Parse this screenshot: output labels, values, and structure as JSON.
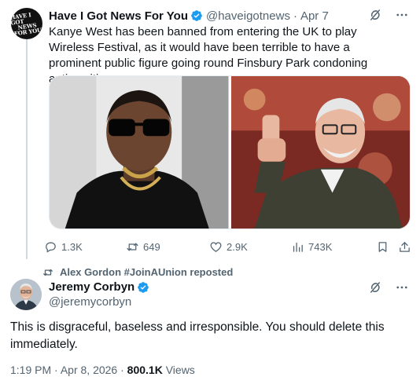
{
  "quoted_tweet": {
    "author_name": "Have I Got News For You",
    "handle": "@haveigotnews",
    "separator": "·",
    "date": "Apr 7",
    "avatar_text": [
      "HAVE I GOT",
      "NEWS",
      "FOR YOU"
    ],
    "text": "Kanye West has been banned from entering the UK to play Wireless Festival, as it would have been terrible to have a prominent public figure going round Finsbury Park condoning antisemitism",
    "stats": {
      "replies": "1.3K",
      "reposts": "649",
      "likes": "2.9K",
      "views": "743K"
    },
    "icons": [
      "grok-icon",
      "more-icon",
      "reply-icon",
      "repost-icon",
      "like-icon",
      "views-icon",
      "bookmark-icon",
      "share-icon"
    ]
  },
  "repost_banner": {
    "text": "Alex Gordon #JoinAUnion reposted"
  },
  "main_tweet": {
    "author_name": "Jeremy Corbyn",
    "handle": "@jeremycorbyn",
    "text": "This is disgraceful, baseless and irresponsible. You should delete this immediately.",
    "time": "1:19 PM",
    "separator": "·",
    "date": "Apr 8, 2026",
    "separator2": "·",
    "views_count": "800.1K",
    "views_label": "Views"
  },
  "colors": {
    "verified_blue": "#1d9bf0",
    "text_primary": "#0f1419",
    "text_secondary": "#536471",
    "divider": "#cfd9de"
  }
}
